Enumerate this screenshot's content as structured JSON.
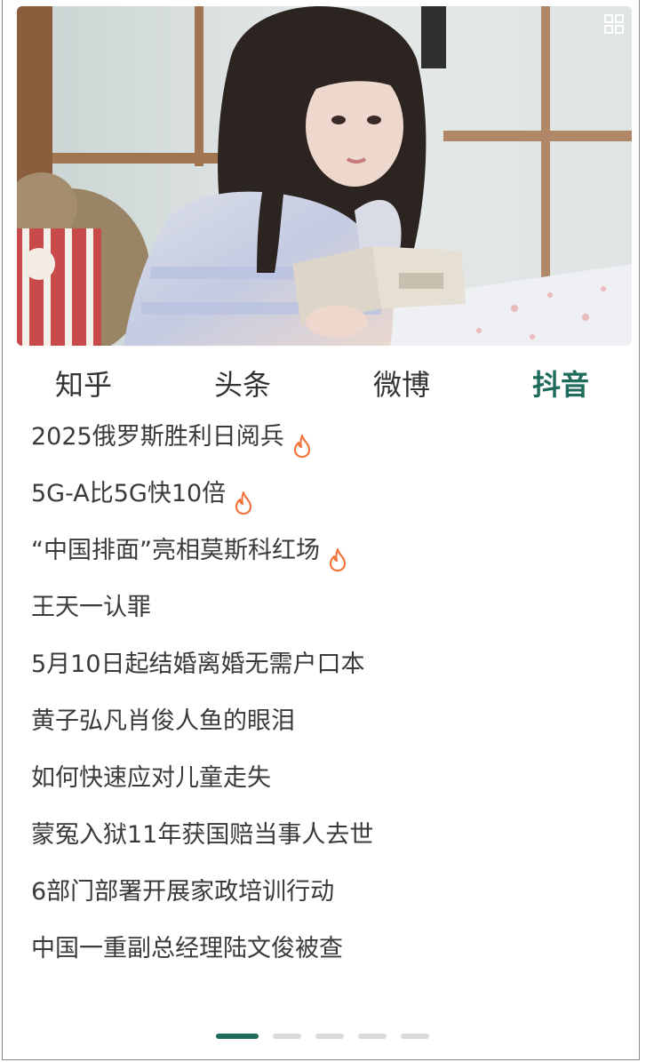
{
  "tabs": [
    {
      "label": "知乎",
      "active": false
    },
    {
      "label": "头条",
      "active": false
    },
    {
      "label": "微博",
      "active": false
    },
    {
      "label": "抖音",
      "active": true
    }
  ],
  "news": [
    {
      "title": "2025俄罗斯胜利日阅兵",
      "hot": true
    },
    {
      "title": "5G-A比5G快10倍",
      "hot": true
    },
    {
      "title": "“中国排面”亮相莫斯科红场",
      "hot": true
    },
    {
      "title": "王天一认罪",
      "hot": false
    },
    {
      "title": "5月10日起结婚离婚无需户口本",
      "hot": false
    },
    {
      "title": "黄子弘凡肖俊人鱼的眼泪",
      "hot": false
    },
    {
      "title": "如何快速应对儿童走失",
      "hot": false
    },
    {
      "title": "蒙冤入狱11年获国赔当事人去世",
      "hot": false
    },
    {
      "title": "6部门部署开展家政培训行动",
      "hot": false
    },
    {
      "title": "中国一重副总经理陆文俊被查",
      "hot": false
    }
  ],
  "pagination": {
    "total": 5,
    "active_index": 0
  },
  "icons": {
    "hot": "flame-icon",
    "layout": "grid-icon"
  },
  "colors": {
    "accent": "#1f6b5c",
    "hot": "#f0733c",
    "text": "#3a3a3a",
    "dot_inactive": "#dadada"
  }
}
